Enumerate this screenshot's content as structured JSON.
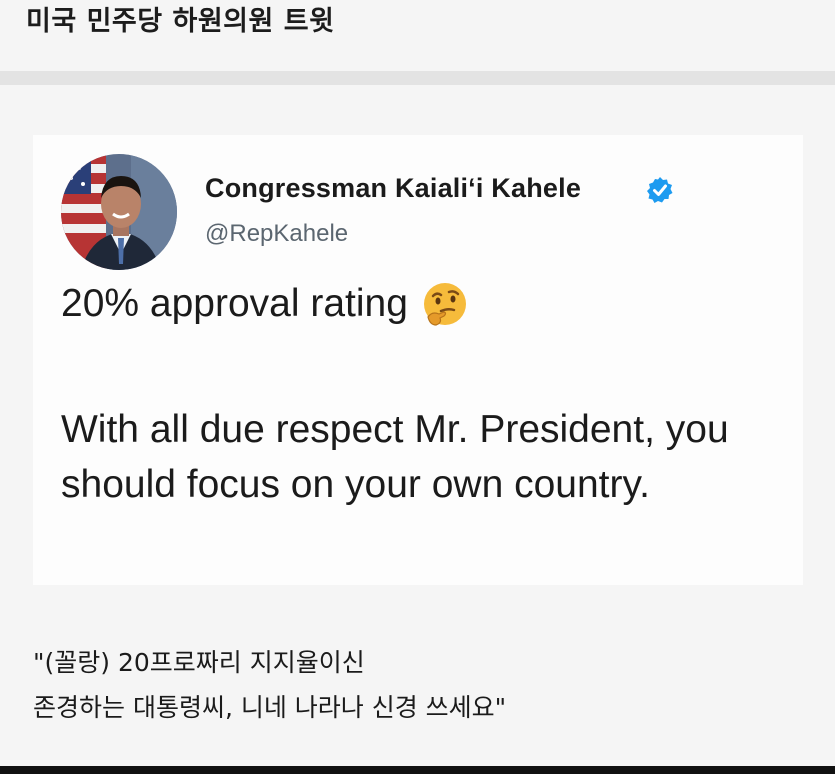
{
  "post": {
    "title": "미국 민주당 하원의원 트윗"
  },
  "tweet": {
    "author": {
      "display_name": "Congressman Kaiali‘i Kahele",
      "handle": "@RepKahele",
      "verified": true,
      "avatar_icon": "profile-photo"
    },
    "line1": "20% approval rating",
    "line1_emoji": "thinking-face-icon",
    "paragraph": "With all due respect Mr. President, you should focus on your own country."
  },
  "caption": {
    "line1": "\"(꼴랑) 20프로짜리 지지율이신",
    "line2": "존경하는 대통령씨, 니네 나라나 신경 쓰세요\""
  },
  "colors": {
    "background": "#f5f5f5",
    "card": "#fdfdfd",
    "verified": "#1d9bf0",
    "handle": "#5b6670"
  }
}
